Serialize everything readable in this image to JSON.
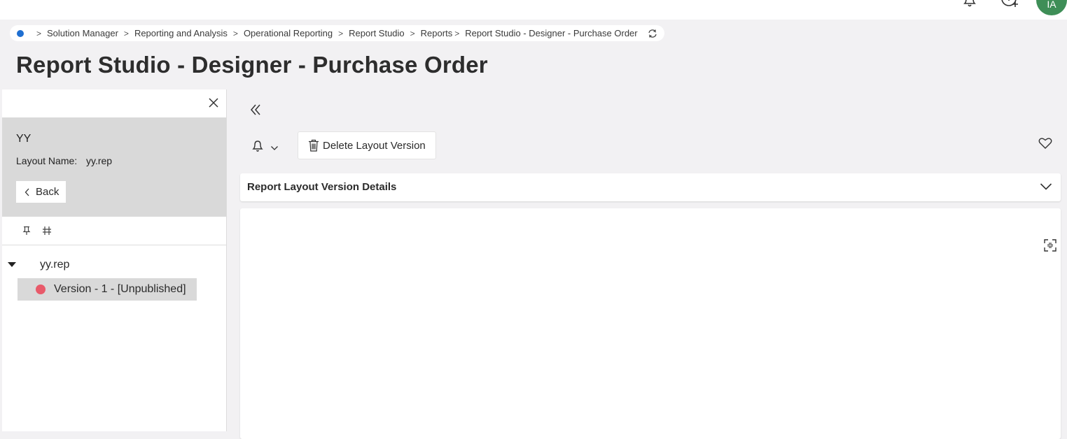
{
  "header": {
    "avatar_initials": "IA",
    "avatar_color": "#3e8e57",
    "icons": [
      "bell-icon",
      "help-icon"
    ]
  },
  "breadcrumb": {
    "home_color": "#1f6fd1",
    "items": [
      "Solution Manager",
      "Reporting and Analysis",
      "Operational Reporting",
      "Report Studio",
      "Reports",
      "Report Studio - Designer - Purchase Order"
    ]
  },
  "page": {
    "title": "Report Studio - Designer - Purchase Order"
  },
  "sidebar": {
    "name": "YY",
    "layout_name_label": "Layout Name:",
    "layout_name_value": "yy.rep",
    "back_label": "Back",
    "tree": {
      "root_label": "yy.rep",
      "child_label": "Version - 1 - [Unpublished]",
      "child_status_color": "#e85a6a"
    }
  },
  "toolbar": {
    "delete_label": "Delete Layout Version"
  },
  "details": {
    "title": "Report Layout Version Details"
  }
}
